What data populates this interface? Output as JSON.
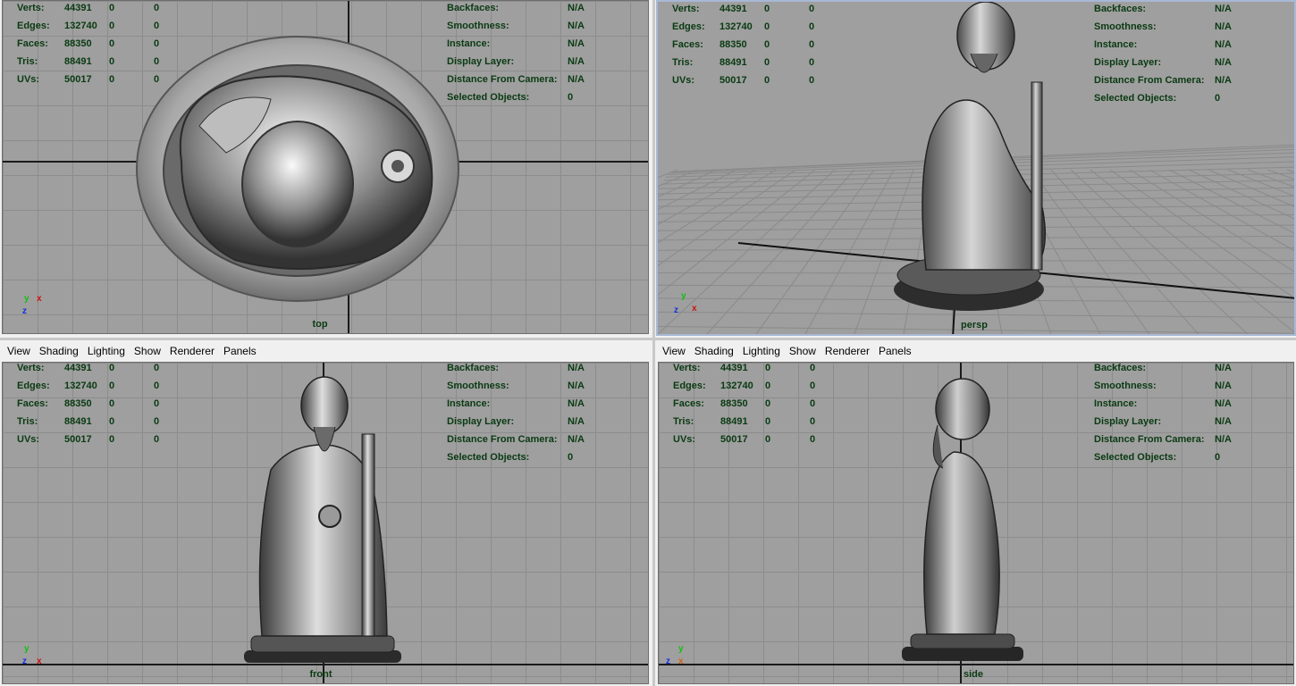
{
  "menu": [
    "View",
    "Shading",
    "Lighting",
    "Show",
    "Renderer",
    "Panels"
  ],
  "hud": {
    "left": [
      {
        "label": "Verts:",
        "v1": "44391",
        "v2": "0",
        "v3": "0"
      },
      {
        "label": "Edges:",
        "v1": "132740",
        "v2": "0",
        "v3": "0"
      },
      {
        "label": "Faces:",
        "v1": "88350",
        "v2": "0",
        "v3": "0"
      },
      {
        "label": "Tris:",
        "v1": "88491",
        "v2": "0",
        "v3": "0"
      },
      {
        "label": "UVs:",
        "v1": "50017",
        "v2": "0",
        "v3": "0"
      }
    ],
    "right": [
      {
        "label": "Backfaces:",
        "value": "N/A"
      },
      {
        "label": "Smoothness:",
        "value": "N/A"
      },
      {
        "label": "Instance:",
        "value": "N/A"
      },
      {
        "label": "Display Layer:",
        "value": "N/A"
      },
      {
        "label": "Distance From Camera:",
        "value": "N/A"
      },
      {
        "label": "Selected Objects:",
        "value": "0"
      }
    ]
  },
  "viewports": {
    "top": {
      "camera": "top"
    },
    "persp": {
      "camera": "persp"
    },
    "front": {
      "camera": "front"
    },
    "side": {
      "camera": "side"
    }
  },
  "colors": {
    "viewport_bg": "#9f9f9f",
    "hud_text": "#0a3a12",
    "active_border": "#a7b8d6",
    "axis_x": "#d01010",
    "axis_y": "#10c010",
    "axis_z": "#1030e0"
  }
}
